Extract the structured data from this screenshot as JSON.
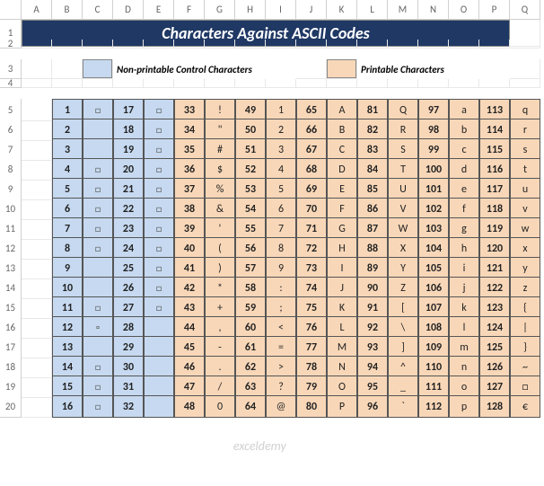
{
  "cols": [
    "A",
    "B",
    "C",
    "D",
    "E",
    "F",
    "G",
    "H",
    "I",
    "J",
    "K",
    "L",
    "M",
    "N",
    "O",
    "P",
    "Q"
  ],
  "rows": [
    "1",
    "2",
    "3",
    "4",
    "5",
    "6",
    "7",
    "8",
    "9",
    "10",
    "11",
    "12",
    "13",
    "14",
    "15",
    "16",
    "17",
    "18",
    "19",
    "20"
  ],
  "title": "Characters Against ASCII Codes",
  "legend": {
    "nonprintable": "Non-printable Control Characters",
    "printable": "Printable Characters"
  },
  "watermark": "exceldemy",
  "placeholder_char": "□",
  "chart_data": {
    "type": "table",
    "title": "Characters Against ASCII Codes",
    "columns": [
      {
        "code": 1,
        "char": "□",
        "cls": "blue"
      },
      {
        "code": 17,
        "char": "□",
        "cls": "blue"
      },
      {
        "code": 33,
        "char": "!",
        "cls": "orange"
      },
      {
        "code": 49,
        "char": "1",
        "cls": "orange"
      },
      {
        "code": 65,
        "char": "A",
        "cls": "orange"
      },
      {
        "code": 81,
        "char": "Q",
        "cls": "orange"
      },
      {
        "code": 97,
        "char": "a",
        "cls": "orange"
      },
      {
        "code": 113,
        "char": "q",
        "cls": "orange"
      }
    ],
    "rows": [
      [
        {
          "n": 1,
          "c": "□"
        },
        {
          "n": 17,
          "c": "□"
        },
        {
          "n": 33,
          "c": "!"
        },
        {
          "n": 49,
          "c": "1"
        },
        {
          "n": 65,
          "c": "A"
        },
        {
          "n": 81,
          "c": "Q"
        },
        {
          "n": 97,
          "c": "a"
        },
        {
          "n": 113,
          "c": "q"
        }
      ],
      [
        {
          "n": 2,
          "c": ""
        },
        {
          "n": 18,
          "c": "□"
        },
        {
          "n": 34,
          "c": "\""
        },
        {
          "n": 50,
          "c": "2"
        },
        {
          "n": 66,
          "c": "B"
        },
        {
          "n": 82,
          "c": "R"
        },
        {
          "n": 98,
          "c": "b"
        },
        {
          "n": 114,
          "c": "r"
        }
      ],
      [
        {
          "n": 3,
          "c": ""
        },
        {
          "n": 19,
          "c": "□"
        },
        {
          "n": 35,
          "c": "#"
        },
        {
          "n": 51,
          "c": "3"
        },
        {
          "n": 67,
          "c": "C"
        },
        {
          "n": 83,
          "c": "S"
        },
        {
          "n": 99,
          "c": "c"
        },
        {
          "n": 115,
          "c": "s"
        }
      ],
      [
        {
          "n": 4,
          "c": "□"
        },
        {
          "n": 20,
          "c": "□"
        },
        {
          "n": 36,
          "c": "$"
        },
        {
          "n": 52,
          "c": "4"
        },
        {
          "n": 68,
          "c": "D"
        },
        {
          "n": 84,
          "c": "T"
        },
        {
          "n": 100,
          "c": "d"
        },
        {
          "n": 116,
          "c": "t"
        }
      ],
      [
        {
          "n": 5,
          "c": "□"
        },
        {
          "n": 21,
          "c": "□"
        },
        {
          "n": 37,
          "c": "%"
        },
        {
          "n": 53,
          "c": "5"
        },
        {
          "n": 69,
          "c": "E"
        },
        {
          "n": 85,
          "c": "U"
        },
        {
          "n": 101,
          "c": "e"
        },
        {
          "n": 117,
          "c": "u"
        }
      ],
      [
        {
          "n": 6,
          "c": "□"
        },
        {
          "n": 22,
          "c": "□"
        },
        {
          "n": 38,
          "c": "&"
        },
        {
          "n": 54,
          "c": "6"
        },
        {
          "n": 70,
          "c": "F"
        },
        {
          "n": 86,
          "c": "V"
        },
        {
          "n": 102,
          "c": "f"
        },
        {
          "n": 118,
          "c": "v"
        }
      ],
      [
        {
          "n": 7,
          "c": "□"
        },
        {
          "n": 23,
          "c": "□"
        },
        {
          "n": 39,
          "c": "'"
        },
        {
          "n": 55,
          "c": "7"
        },
        {
          "n": 71,
          "c": "G"
        },
        {
          "n": 87,
          "c": "W"
        },
        {
          "n": 103,
          "c": "g"
        },
        {
          "n": 119,
          "c": "w"
        }
      ],
      [
        {
          "n": 8,
          "c": "□"
        },
        {
          "n": 24,
          "c": "□"
        },
        {
          "n": 40,
          "c": "("
        },
        {
          "n": 56,
          "c": "8"
        },
        {
          "n": 72,
          "c": "H"
        },
        {
          "n": 88,
          "c": "X"
        },
        {
          "n": 104,
          "c": "h"
        },
        {
          "n": 120,
          "c": "x"
        }
      ],
      [
        {
          "n": 9,
          "c": ""
        },
        {
          "n": 25,
          "c": "□"
        },
        {
          "n": 41,
          "c": ")"
        },
        {
          "n": 57,
          "c": "9"
        },
        {
          "n": 73,
          "c": "I"
        },
        {
          "n": 89,
          "c": "Y"
        },
        {
          "n": 105,
          "c": "i"
        },
        {
          "n": 121,
          "c": "y"
        }
      ],
      [
        {
          "n": 10,
          "c": ""
        },
        {
          "n": 26,
          "c": "□"
        },
        {
          "n": 42,
          "c": "*"
        },
        {
          "n": 58,
          "c": ":"
        },
        {
          "n": 74,
          "c": "J"
        },
        {
          "n": 90,
          "c": "Z"
        },
        {
          "n": 106,
          "c": "j"
        },
        {
          "n": 122,
          "c": "z"
        }
      ],
      [
        {
          "n": 11,
          "c": "□"
        },
        {
          "n": 27,
          "c": "□"
        },
        {
          "n": 43,
          "c": "+"
        },
        {
          "n": 59,
          "c": ";"
        },
        {
          "n": 75,
          "c": "K"
        },
        {
          "n": 91,
          "c": "["
        },
        {
          "n": 107,
          "c": "k"
        },
        {
          "n": 123,
          "c": "{"
        }
      ],
      [
        {
          "n": 12,
          "c": "▫"
        },
        {
          "n": 28,
          "c": ""
        },
        {
          "n": 44,
          "c": ","
        },
        {
          "n": 60,
          "c": "<"
        },
        {
          "n": 76,
          "c": "L"
        },
        {
          "n": 92,
          "c": "\\"
        },
        {
          "n": 108,
          "c": "l"
        },
        {
          "n": 124,
          "c": "|"
        }
      ],
      [
        {
          "n": 13,
          "c": ""
        },
        {
          "n": 29,
          "c": ""
        },
        {
          "n": 45,
          "c": "-"
        },
        {
          "n": 61,
          "c": "="
        },
        {
          "n": 77,
          "c": "M"
        },
        {
          "n": 93,
          "c": "]"
        },
        {
          "n": 109,
          "c": "m"
        },
        {
          "n": 125,
          "c": "}"
        }
      ],
      [
        {
          "n": 14,
          "c": "□"
        },
        {
          "n": 30,
          "c": ""
        },
        {
          "n": 46,
          "c": "."
        },
        {
          "n": 62,
          "c": ">"
        },
        {
          "n": 78,
          "c": "N"
        },
        {
          "n": 94,
          "c": "^"
        },
        {
          "n": 110,
          "c": "n"
        },
        {
          "n": 126,
          "c": "~"
        }
      ],
      [
        {
          "n": 15,
          "c": "□"
        },
        {
          "n": 31,
          "c": ""
        },
        {
          "n": 47,
          "c": "/"
        },
        {
          "n": 63,
          "c": "?"
        },
        {
          "n": 79,
          "c": "O"
        },
        {
          "n": 95,
          "c": "_"
        },
        {
          "n": 111,
          "c": "o"
        },
        {
          "n": 127,
          "c": "□"
        }
      ],
      [
        {
          "n": 16,
          "c": "□"
        },
        {
          "n": 32,
          "c": " "
        },
        {
          "n": 48,
          "c": "0"
        },
        {
          "n": 64,
          "c": "@"
        },
        {
          "n": 80,
          "c": "P"
        },
        {
          "n": 96,
          "c": "`"
        },
        {
          "n": 112,
          "c": "p"
        },
        {
          "n": 128,
          "c": "€"
        }
      ]
    ]
  }
}
